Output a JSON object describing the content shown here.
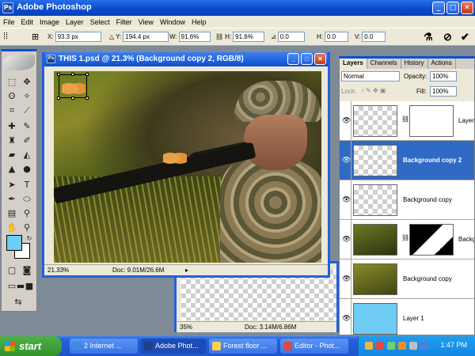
{
  "app": {
    "title": "Adobe Photoshop",
    "icon": "photoshop-icon",
    "window_buttons": [
      "_",
      "□",
      "✕"
    ]
  },
  "menu": [
    "File",
    "Edit",
    "Image",
    "Layer",
    "Select",
    "Filter",
    "View",
    "Window",
    "Help"
  ],
  "options_bar": {
    "x_label": "X:",
    "x_value": "93.3 px",
    "y_label": "Y:",
    "y_value": "194.4 px",
    "w_label": "W:",
    "w_value": "91.6%",
    "h_label": "H:",
    "h_value": "91.6%",
    "angle_value": "0.0",
    "hskew_label": "H:",
    "hskew_value": "0.0",
    "vskew_label": "V:",
    "vskew_value": "0.0",
    "cancel_symbol": "⊘",
    "commit_symbol": "✔"
  },
  "toolbox": {
    "foreground_color": "#6fcdf5",
    "background_color": "#ffffff"
  },
  "document_main": {
    "title": "THIS 1.psd @ 21.3% (Background copy 2, RGB/8)",
    "zoom": "21.33%",
    "doc_info": "Doc: 9.01M/26.6M"
  },
  "document_back": {
    "zoom": "35%",
    "doc_info": "Doc: 3.14M/6.86M"
  },
  "layers_panel": {
    "tabs": [
      "Layers",
      "Channels",
      "History",
      "Actions"
    ],
    "blend_mode": "Normal",
    "opacity_label": "Opacity:",
    "opacity_value": "100%",
    "lock_label": "Lock:",
    "fill_label": "Fill:",
    "fill_value": "100%",
    "layers": [
      {
        "name": "Layer",
        "selected": false
      },
      {
        "name": "Background copy 2",
        "selected": true
      },
      {
        "name": "Background copy",
        "selected": false
      },
      {
        "name": "Backg",
        "selected": false
      },
      {
        "name": "Background copy",
        "selected": false
      },
      {
        "name": "Layer 1",
        "selected": false
      }
    ],
    "layer1_color": "#6fcdf5"
  },
  "taskbar": {
    "start_label": "start",
    "tasks": [
      "2 Internet ...",
      "Adobe Phot...",
      "Forest floor ...",
      "Editor - Phot..."
    ],
    "clock": "1:47 PM"
  }
}
